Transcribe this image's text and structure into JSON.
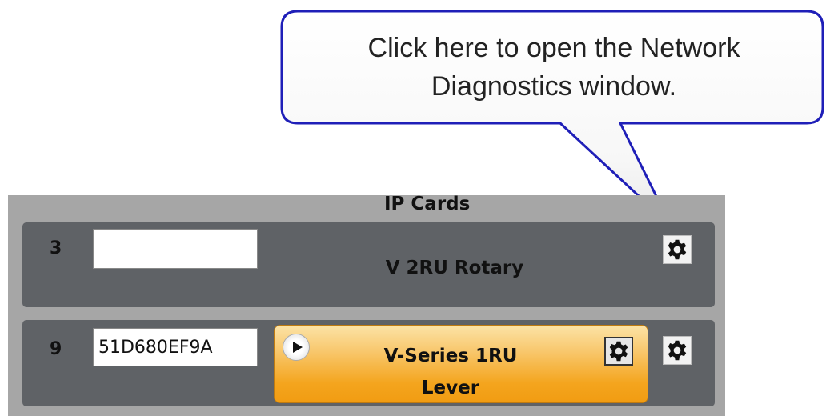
{
  "callout": {
    "line1": "Click here to open the Network",
    "line2": "Diagnostics window."
  },
  "panel": {
    "title": "IP Cards",
    "rows": [
      {
        "slot": "3",
        "id_value": "",
        "card_name": "V 2RU Rotary"
      },
      {
        "slot": "9",
        "id_value": "51D680EF9A",
        "device_line1": "V-Series 1RU",
        "device_line2": "Lever"
      }
    ]
  },
  "icons": {
    "gear": "gear-icon",
    "play": "play-icon"
  },
  "colors": {
    "callout_border": "#1f1fb8",
    "panel_bg": "#a6a6a6",
    "row_bg": "#5f6266",
    "device_orange": "#f4a51e"
  }
}
